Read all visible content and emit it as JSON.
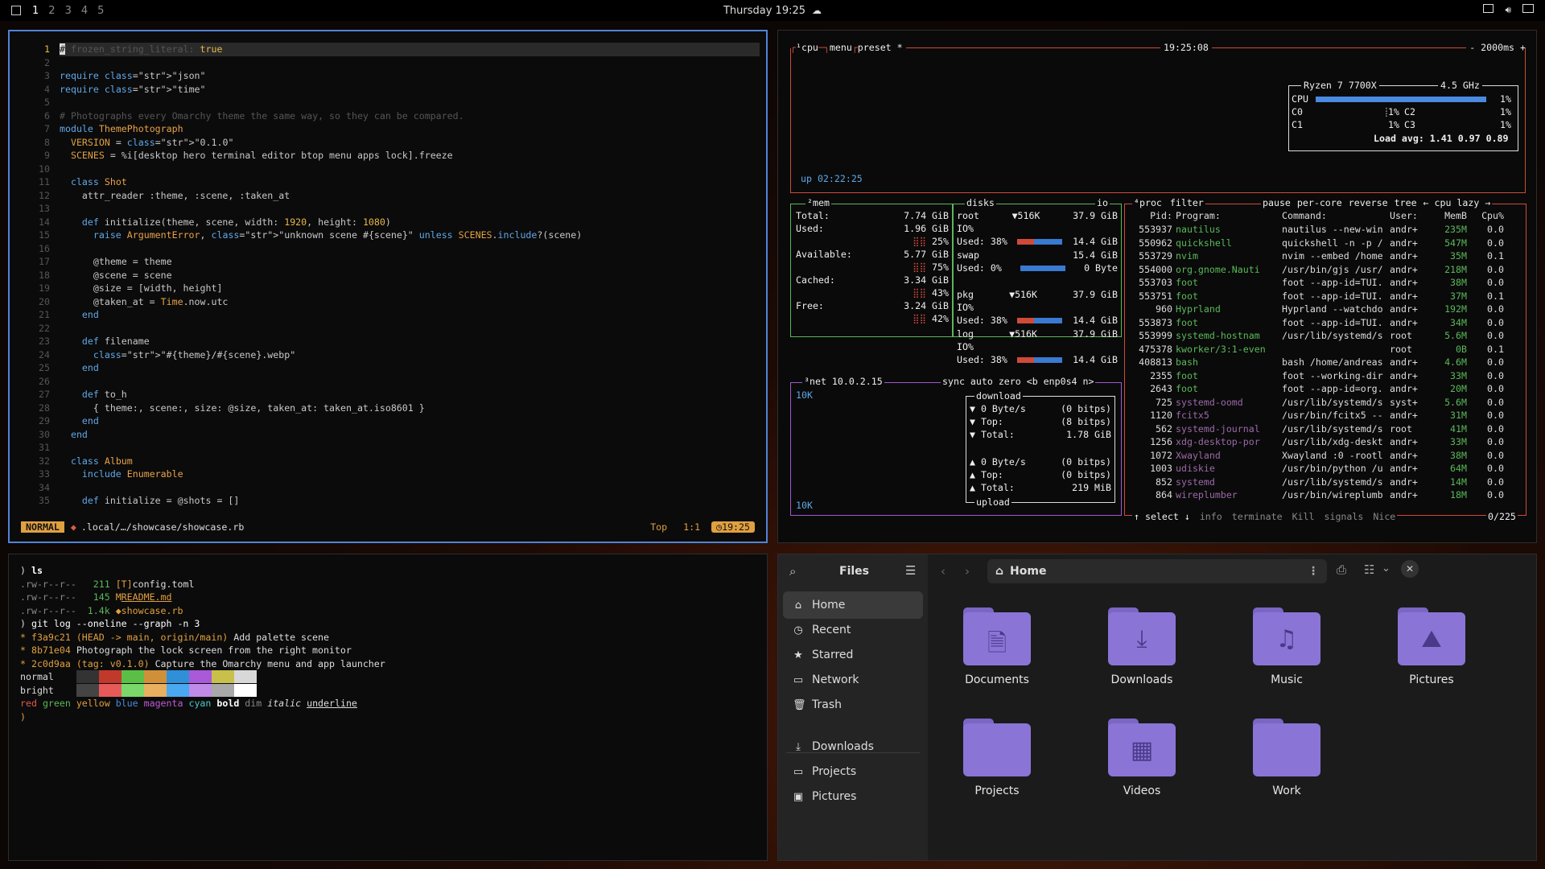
{
  "topbar": {
    "workspaces": [
      "1",
      "2",
      "3",
      "4",
      "5"
    ],
    "active_workspace": "1",
    "clock": "Thursday 19:25",
    "weather_icon": "cloud-icon",
    "tray_icons": [
      "window-icon",
      "volume-icon",
      "monitor-icon"
    ]
  },
  "editor": {
    "line_numbers": [
      "1",
      "2",
      "3",
      "4",
      "5",
      "6",
      "7",
      "8",
      "9",
      "10",
      "11",
      "12",
      "13",
      "14",
      "15",
      "16",
      "17",
      "18",
      "19",
      "20",
      "21",
      "22",
      "23",
      "24",
      "25",
      "26",
      "27",
      "28",
      "29",
      "30",
      "31",
      "32",
      "33",
      "34",
      "35"
    ],
    "lines": [
      "# frozen_string_literal: true",
      "",
      "require \"json\"",
      "require \"time\"",
      "",
      "# Photographs every Omarchy theme the same way, so they can be compared.",
      "module ThemePhotograph",
      "  VERSION = \"0.1.0\"",
      "  SCENES = %i[desktop hero terminal editor btop menu apps lock].freeze",
      "",
      "  class Shot",
      "    attr_reader :theme, :scene, :taken_at",
      "",
      "    def initialize(theme, scene, width: 1920, height: 1080)",
      "      raise ArgumentError, \"unknown scene #{scene}\" unless SCENES.include?(scene)",
      "",
      "      @theme = theme",
      "      @scene = scene",
      "      @size = [width, height]",
      "      @taken_at = Time.now.utc",
      "    end",
      "",
      "    def filename",
      "      \"#{theme}/#{scene}.webp\"",
      "    end",
      "",
      "    def to_h",
      "      { theme:, scene:, size: @size, taken_at: taken_at.iso8601 }",
      "    end",
      "  end",
      "",
      "  class Album",
      "    include Enumerable",
      "",
      "    def initialize = @shots = []"
    ],
    "status": {
      "mode": "NORMAL",
      "path": ".local/…/showcase/showcase.rb",
      "position": "Top",
      "cursor": "1:1",
      "time": "19:25"
    }
  },
  "btop": {
    "cpu_header": {
      "label": "¹cpu",
      "menu": "menu",
      "preset": "preset *",
      "time": "19:25:08",
      "interval": "- 2000ms +"
    },
    "cpu_info": {
      "model": "Ryzen 7 7700X",
      "freq": "4.5 GHz",
      "cpu_label": "CPU",
      "cpu_pct": "1%",
      "c0": "C0",
      "c0_pct": "1%",
      "c1": "C1",
      "c1_pct": "1%",
      "c2": "C2",
      "c2_pct": "1%",
      "c3": "C3",
      "c3_pct": "1%",
      "load": "Load avg: 1.41 0.97 0.89",
      "cpu_usage": 0.01
    },
    "uptime": "up 02:22:25",
    "mem": {
      "header": "²mem",
      "total_label": "Total:",
      "total": "7.74 GiB",
      "used_label": "Used:",
      "used": "1.96 GiB",
      "used_pct": "25%",
      "avail_label": "Available:",
      "avail": "5.77 GiB",
      "avail_pct": "75%",
      "cached_label": "Cached:",
      "cached": "3.34 GiB",
      "cached_pct": "43%",
      "free_label": "Free:",
      "free": "3.24 GiB",
      "free_pct": "42%"
    },
    "disks": {
      "header": "disks",
      "io": "io",
      "items": [
        {
          "name": "root",
          "io": "▼516K",
          "size": "37.9 GiB",
          "l2": "IO%",
          "used_pct": "38%",
          "used": "14.4 GiB",
          "fill": 0.38
        },
        {
          "name": "swap",
          "io": "",
          "size": "15.4 GiB",
          "l2": "",
          "used_pct": "0%",
          "used": "0 Byte",
          "fill": 0.0
        },
        {
          "name": "pkg",
          "io": "▼516K",
          "size": "37.9 GiB",
          "l2": "IO%",
          "used_pct": "38%",
          "used": "14.4 GiB",
          "fill": 0.38
        },
        {
          "name": "log",
          "io": "▼516K",
          "size": "37.9 GiB",
          "l2": "IO%",
          "used_pct": "38%",
          "used": "14.4 GiB",
          "fill": 0.38
        }
      ]
    },
    "net": {
      "header": "³net",
      "ip": "10.0.2.15",
      "sync": "sync",
      "auto": "auto",
      "zero": "zero",
      "iface": "<b enp0s4 n>",
      "scale_top": "10K",
      "scale_bottom": "10K",
      "download": "download",
      "dl_rate": "0 Byte/s",
      "dl_bits": "(0 bitps)",
      "dl_top_label": "Top:",
      "dl_top": "(8 bitps)",
      "dl_total_label": "Total:",
      "dl_total": "1.78 GiB",
      "ul_rate": "0 Byte/s",
      "ul_bits": "(0 bitps)",
      "ul_top_label": "Top:",
      "ul_top": "(0 bitps)",
      "ul_total_label": "Total:",
      "ul_total": "219 MiB",
      "upload": "upload"
    },
    "proc": {
      "header": "⁴proc",
      "filter": "filter",
      "pause": "pause",
      "percore": "per-core",
      "reverse": "reverse",
      "tree": "tree",
      "sort": "← cpu lazy →",
      "cols": {
        "pid": "Pid:",
        "program": "Program:",
        "command": "Command:",
        "user": "User:",
        "mem": "MemB",
        "cpu": "Cpu%"
      },
      "rows": [
        [
          "553937",
          "nautilus",
          "nautilus --new-win",
          "andr+",
          "235M",
          "0.0"
        ],
        [
          "550962",
          "quickshell",
          "quickshell -n -p /",
          "andr+",
          "547M",
          "0.0"
        ],
        [
          "553729",
          "nvim",
          "nvim --embed /home",
          "andr+",
          "35M",
          "0.1"
        ],
        [
          "554000",
          "org.gnome.Nauti",
          "/usr/bin/gjs /usr/",
          "andr+",
          "218M",
          "0.0"
        ],
        [
          "553703",
          "foot",
          "foot --app-id=TUI.",
          "andr+",
          "38M",
          "0.0"
        ],
        [
          "553751",
          "foot",
          "foot --app-id=TUI.",
          "andr+",
          "37M",
          "0.1"
        ],
        [
          "960",
          "Hyprland",
          "Hyprland --watchdo",
          "andr+",
          "192M",
          "0.0"
        ],
        [
          "553873",
          "foot",
          "foot --app-id=TUI.",
          "andr+",
          "34M",
          "0.0"
        ],
        [
          "553999",
          "systemd-hostnam",
          "/usr/lib/systemd/s",
          "root",
          "5.6M",
          "0.0"
        ],
        [
          "475378",
          "kworker/3:1-even",
          "",
          "root",
          "0B",
          "0.1"
        ],
        [
          "408813",
          "bash",
          "bash /home/andreas",
          "andr+",
          "4.6M",
          "0.0"
        ],
        [
          "2355",
          "foot",
          "foot --working-dir",
          "andr+",
          "33M",
          "0.0"
        ],
        [
          "2643",
          "foot",
          "foot --app-id=org.",
          "andr+",
          "20M",
          "0.0"
        ],
        [
          "725",
          "systemd-oomd",
          "/usr/lib/systemd/s",
          "syst+",
          "5.6M",
          "0.0"
        ],
        [
          "1120",
          "fcitx5",
          "/usr/bin/fcitx5 --",
          "andr+",
          "31M",
          "0.0"
        ],
        [
          "562",
          "systemd-journal",
          "/usr/lib/systemd/s",
          "root",
          "41M",
          "0.0"
        ],
        [
          "1256",
          "xdg-desktop-por",
          "/usr/lib/xdg-deskt",
          "andr+",
          "33M",
          "0.0"
        ],
        [
          "1072",
          "Xwayland",
          "Xwayland :0 -rootl",
          "andr+",
          "38M",
          "0.0"
        ],
        [
          "1003",
          "udiskie",
          "/usr/bin/python /u",
          "andr+",
          "64M",
          "0.0"
        ],
        [
          "852",
          "systemd",
          "/usr/lib/systemd/s",
          "andr+",
          "14M",
          "0.0"
        ],
        [
          "864",
          "wireplumber",
          "/usr/bin/wireplumb",
          "andr+",
          "18M",
          "0.0"
        ]
      ],
      "footer": {
        "select": "↑ select ↓",
        "info": "info",
        "terminate": "terminate",
        "kill": "Kill",
        "signals": "signals",
        "nice": "Nice",
        "count": "0/225"
      }
    }
  },
  "terminal": {
    "prompt": ")",
    "cmd1": "ls",
    "files": [
      {
        "perm": ".rw-r--r--",
        "size": "211",
        "icon": "[T]",
        "name": "config.toml"
      },
      {
        "perm": ".rw-r--r--",
        "size": "145",
        "icon": "M",
        "name": "README.md"
      },
      {
        "perm": ".rw-r--r--",
        "size": "1.4k",
        "icon": "◆",
        "name": "showcase.rb"
      }
    ],
    "cmd2": "git log --oneline --graph -n 3",
    "commits": [
      {
        "hash": "f3a9c21",
        "ref": "(HEAD -> main, origin/main)",
        "msg": "Add palette scene"
      },
      {
        "hash": "8b71e04",
        "ref": "",
        "msg": "Photograph the lock screen from the right monitor"
      },
      {
        "hash": "2c0d9aa",
        "ref": "(tag: v0.1.0)",
        "msg": "Capture the Omarchy menu and app launcher"
      }
    ],
    "normal_label": "normal",
    "bright_label": "bright",
    "normal_colors": [
      "#333333",
      "#c0392b",
      "#5bbf45",
      "#d0903a",
      "#2f8fd8",
      "#a85ad8",
      "#c8c04a",
      "#d8d8d8"
    ],
    "bright_colors": [
      "#444444",
      "#e85a5a",
      "#7ad86a",
      "#e8b060",
      "#4aa8f0",
      "#c08ae8",
      "#a8a8a8",
      "#ffffff"
    ],
    "styles": [
      "red",
      "green",
      "yellow",
      "blue",
      "magenta",
      "cyan",
      "bold",
      "dim",
      "italic",
      "underline"
    ]
  },
  "files": {
    "title": "Files",
    "location": "Home",
    "sidebar": [
      {
        "label": "Home",
        "icon": "home-icon"
      },
      {
        "label": "Recent",
        "icon": "clock-icon"
      },
      {
        "label": "Starred",
        "icon": "star-icon"
      },
      {
        "label": "Network",
        "icon": "network-icon"
      },
      {
        "label": "Trash",
        "icon": "trash-icon"
      },
      {
        "label": "Downloads",
        "icon": "download-icon"
      },
      {
        "label": "Projects",
        "icon": "folder-icon"
      },
      {
        "label": "Pictures",
        "icon": "picture-icon"
      }
    ],
    "folders": [
      {
        "label": "Documents",
        "glyph": "🗎"
      },
      {
        "label": "Downloads",
        "glyph": "⤓"
      },
      {
        "label": "Music",
        "glyph": "♫"
      },
      {
        "label": "Pictures",
        "glyph": "⛰"
      },
      {
        "label": "Projects",
        "glyph": ""
      },
      {
        "label": "Videos",
        "glyph": "▦"
      },
      {
        "label": "Work",
        "glyph": ""
      }
    ]
  }
}
